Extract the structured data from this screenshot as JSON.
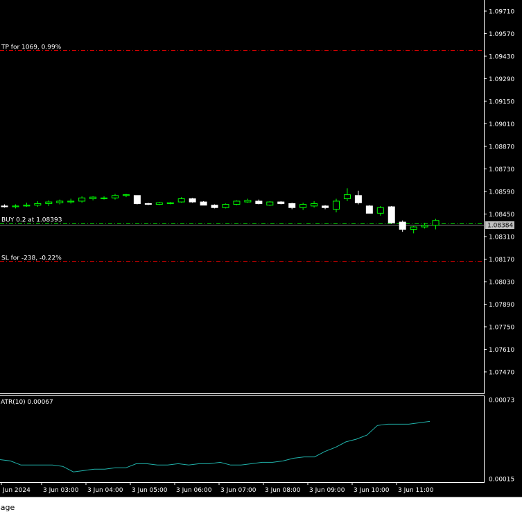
{
  "main_chart": {
    "price_axis_labels": [
      "1.09710",
      "1.09570",
      "1.09430",
      "1.09290",
      "1.09150",
      "1.09010",
      "1.08870",
      "1.08730",
      "1.08590",
      "1.08450",
      "1.08310",
      "1.08170",
      "1.08030",
      "1.07890",
      "1.07750",
      "1.07610",
      "1.07470"
    ],
    "current_price": "1.08384",
    "tp_label": "TP for 1069, 0.99%",
    "buy_label": "BUY 0.2 at 1.08393",
    "sl_label": "SL for -238, -0.22%",
    "colors": {
      "background": "#000000",
      "bull": "#00ff00",
      "bear": "#ffffff",
      "tp_sl_line": "#ff0000",
      "entry_line": "#00c000",
      "indicator": "#20b2aa",
      "axis": "#ffffff"
    }
  },
  "indicator": {
    "label": "ATR(10) 0.00067",
    "axis_labels": [
      "0.00073",
      "0.00015"
    ]
  },
  "time_axis": {
    "labels": [
      "Jun 2024",
      "3 Jun 03:00",
      "3 Jun 04:00",
      "3 Jun 05:00",
      "3 Jun 06:00",
      "3 Jun 07:00",
      "3 Jun 08:00",
      "3 Jun 09:00",
      "3 Jun 10:00",
      "3 Jun 11:00"
    ]
  },
  "message_strip": {
    "text": "sage"
  },
  "chart_data": {
    "type": "candlestick",
    "price_levels": {
      "tp": 1.0947,
      "entry": 1.08393,
      "sl": 1.0816,
      "current": 1.08384
    },
    "candles": [
      {
        "o": 1.085,
        "h": 1.0851,
        "l": 1.0849,
        "c": 1.08495
      },
      {
        "o": 1.08495,
        "h": 1.0851,
        "l": 1.08485,
        "c": 1.085
      },
      {
        "o": 1.085,
        "h": 1.0852,
        "l": 1.08495,
        "c": 1.08505
      },
      {
        "o": 1.08505,
        "h": 1.0853,
        "l": 1.08495,
        "c": 1.08515
      },
      {
        "o": 1.08515,
        "h": 1.08535,
        "l": 1.085,
        "c": 1.08525
      },
      {
        "o": 1.0852,
        "h": 1.0854,
        "l": 1.0851,
        "c": 1.0853
      },
      {
        "o": 1.08525,
        "h": 1.08545,
        "l": 1.08515,
        "c": 1.0853
      },
      {
        "o": 1.0853,
        "h": 1.0856,
        "l": 1.0852,
        "c": 1.0855
      },
      {
        "o": 1.08545,
        "h": 1.0856,
        "l": 1.08535,
        "c": 1.08555
      },
      {
        "o": 1.0855,
        "h": 1.0856,
        "l": 1.0854,
        "c": 1.0855
      },
      {
        "o": 1.0855,
        "h": 1.08575,
        "l": 1.0854,
        "c": 1.08565
      },
      {
        "o": 1.08565,
        "h": 1.08575,
        "l": 1.08555,
        "c": 1.0857
      },
      {
        "o": 1.08565,
        "h": 1.08565,
        "l": 1.0851,
        "c": 1.08515
      },
      {
        "o": 1.08515,
        "h": 1.0852,
        "l": 1.08505,
        "c": 1.0851
      },
      {
        "o": 1.0851,
        "h": 1.08525,
        "l": 1.08505,
        "c": 1.0852
      },
      {
        "o": 1.08515,
        "h": 1.08525,
        "l": 1.0851,
        "c": 1.0852
      },
      {
        "o": 1.08525,
        "h": 1.08555,
        "l": 1.0852,
        "c": 1.08545
      },
      {
        "o": 1.08545,
        "h": 1.0855,
        "l": 1.0852,
        "c": 1.08525
      },
      {
        "o": 1.08525,
        "h": 1.0853,
        "l": 1.08505,
        "c": 1.08505
      },
      {
        "o": 1.08505,
        "h": 1.0851,
        "l": 1.08485,
        "c": 1.0849
      },
      {
        "o": 1.0849,
        "h": 1.08515,
        "l": 1.08485,
        "c": 1.0851
      },
      {
        "o": 1.0851,
        "h": 1.08535,
        "l": 1.08505,
        "c": 1.0853
      },
      {
        "o": 1.08525,
        "h": 1.08545,
        "l": 1.0852,
        "c": 1.08535
      },
      {
        "o": 1.0853,
        "h": 1.0854,
        "l": 1.0851,
        "c": 1.08515
      },
      {
        "o": 1.08505,
        "h": 1.0853,
        "l": 1.085,
        "c": 1.08525
      },
      {
        "o": 1.08525,
        "h": 1.0853,
        "l": 1.0851,
        "c": 1.08515
      },
      {
        "o": 1.08515,
        "h": 1.0852,
        "l": 1.0848,
        "c": 1.0849
      },
      {
        "o": 1.0849,
        "h": 1.0852,
        "l": 1.08475,
        "c": 1.0851
      },
      {
        "o": 1.085,
        "h": 1.0853,
        "l": 1.0849,
        "c": 1.08515
      },
      {
        "o": 1.085,
        "h": 1.08505,
        "l": 1.0848,
        "c": 1.0849
      },
      {
        "o": 1.0848,
        "h": 1.08545,
        "l": 1.0846,
        "c": 1.0853
      },
      {
        "o": 1.08545,
        "h": 1.0861,
        "l": 1.0853,
        "c": 1.0857
      },
      {
        "o": 1.08565,
        "h": 1.08595,
        "l": 1.0851,
        "c": 1.0852
      },
      {
        "o": 1.085,
        "h": 1.08505,
        "l": 1.08455,
        "c": 1.08455
      },
      {
        "o": 1.08455,
        "h": 1.085,
        "l": 1.0844,
        "c": 1.0849
      },
      {
        "o": 1.08495,
        "h": 1.085,
        "l": 1.0839,
        "c": 1.08395
      },
      {
        "o": 1.084,
        "h": 1.0841,
        "l": 1.0834,
        "c": 1.08355
      },
      {
        "o": 1.08355,
        "h": 1.08375,
        "l": 1.0833,
        "c": 1.0837
      },
      {
        "o": 1.0837,
        "h": 1.08395,
        "l": 1.0836,
        "c": 1.0838
      },
      {
        "o": 1.0838,
        "h": 1.0842,
        "l": 1.08355,
        "c": 1.0841
      }
    ],
    "atr_range": [
      0.00015,
      0.00073
    ],
    "atr_values": [
      0.00029,
      0.00028,
      0.00025,
      0.00025,
      0.00025,
      0.00025,
      0.00024,
      0.0002,
      0.00021,
      0.00022,
      0.00022,
      0.00023,
      0.00023,
      0.00026,
      0.00026,
      0.00025,
      0.00025,
      0.00026,
      0.00025,
      0.00026,
      0.00026,
      0.00027,
      0.00025,
      0.00025,
      0.00026,
      0.00027,
      0.00027,
      0.00028,
      0.0003,
      0.00031,
      0.00031,
      0.00035,
      0.00038,
      0.00042,
      0.00044,
      0.00047,
      0.00054,
      0.00055,
      0.00055,
      0.00055,
      0.00056,
      0.00057
    ]
  }
}
